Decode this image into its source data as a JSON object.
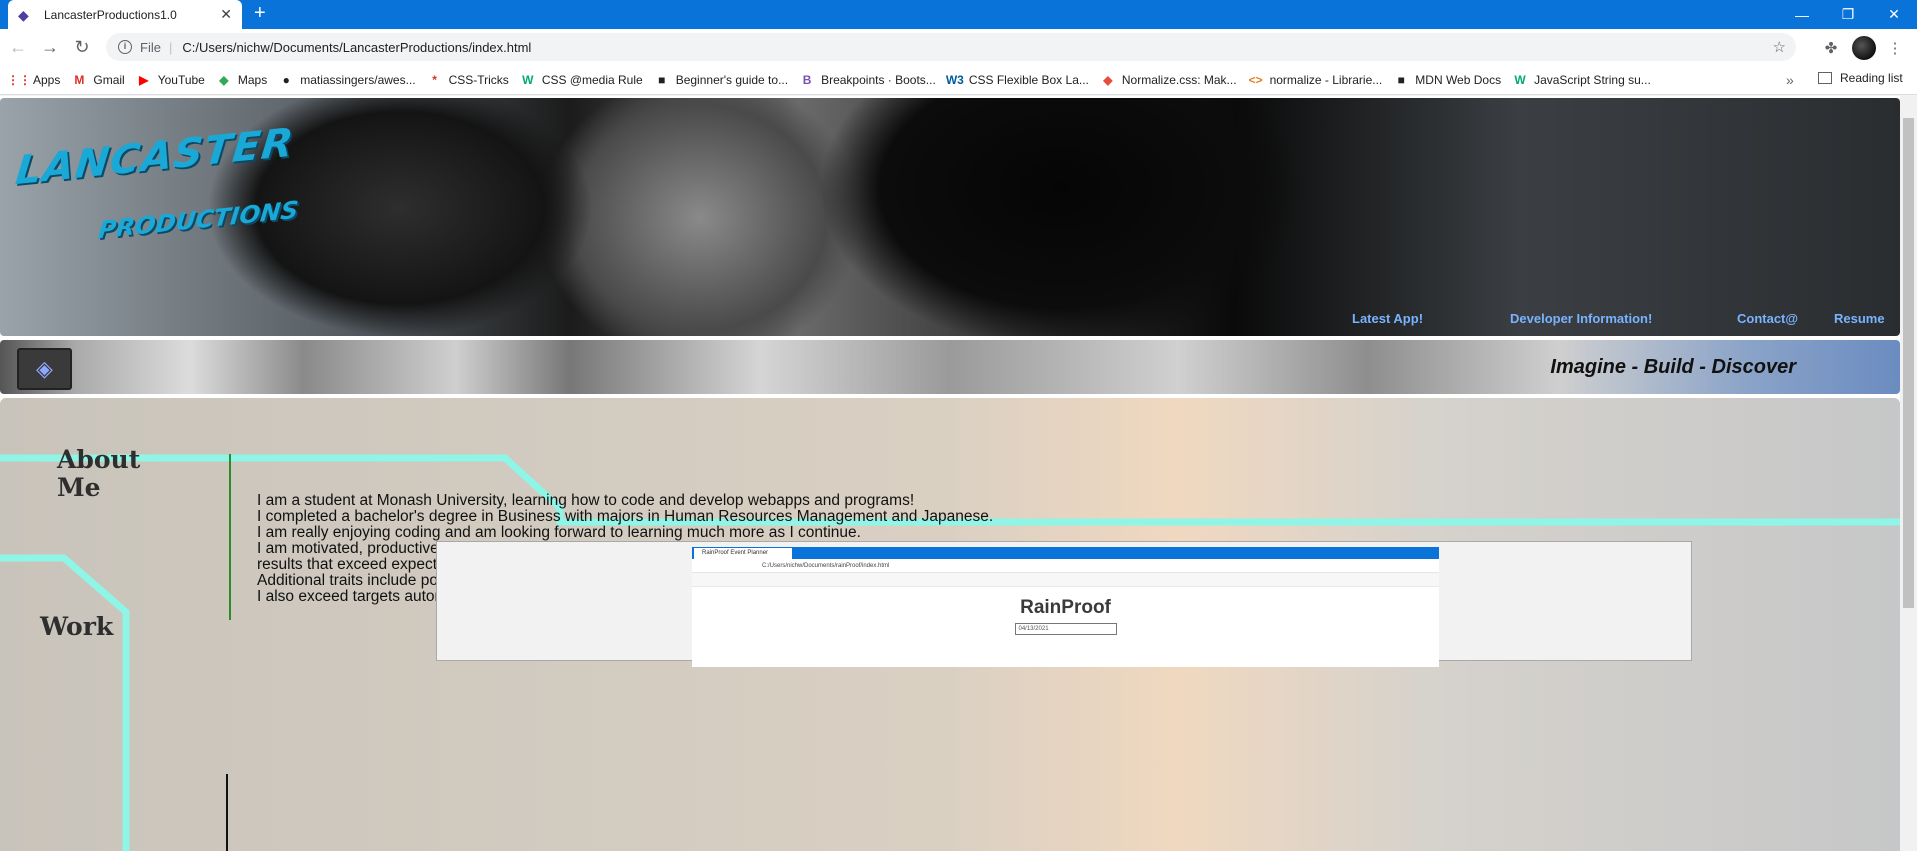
{
  "browser": {
    "tab_title": "LancasterProductions1.0",
    "new_tab": "+",
    "tab_close": "✕",
    "window_controls": {
      "minimize": "—",
      "restore": "❐",
      "close": "✕"
    },
    "nav": {
      "back": "←",
      "forward": "→",
      "reload": "↻"
    },
    "address": {
      "scheme_label": "File",
      "url": "C:/Users/nichw/Documents/LancasterProductions/index.html"
    },
    "bookmarks": [
      {
        "label": "Apps",
        "icon": "apps-grid-icon",
        "glyph": "⋮⋮",
        "color": "#d93025"
      },
      {
        "label": "Gmail",
        "icon": "gmail-icon",
        "glyph": "M",
        "color": "#d93025"
      },
      {
        "label": "YouTube",
        "icon": "youtube-icon",
        "glyph": "▶",
        "color": "#ff0000"
      },
      {
        "label": "Maps",
        "icon": "maps-icon",
        "glyph": "◆",
        "color": "#34a853"
      },
      {
        "label": "matiassingers/awes...",
        "icon": "github-icon",
        "glyph": "●",
        "color": "#202124"
      },
      {
        "label": "CSS-Tricks",
        "icon": "css-tricks-icon",
        "glyph": "*",
        "color": "#d93025"
      },
      {
        "label": "CSS @media Rule",
        "icon": "w3schools-icon",
        "glyph": "W",
        "color": "#04aa6d"
      },
      {
        "label": "Beginner's guide to...",
        "icon": "bookmark-page-icon",
        "glyph": "■",
        "color": "#202124"
      },
      {
        "label": "Breakpoints · Boots...",
        "icon": "bootstrap-icon",
        "glyph": "B",
        "color": "#7952b3"
      },
      {
        "label": "CSS Flexible Box La...",
        "icon": "w3c-icon",
        "glyph": "W3",
        "color": "#005a9c"
      },
      {
        "label": "Normalize.css: Mak...",
        "icon": "normalize-icon",
        "glyph": "◆",
        "color": "#e74c3c"
      },
      {
        "label": "normalize - Librarie...",
        "icon": "code-icon",
        "glyph": "<>",
        "color": "#e67e22"
      },
      {
        "label": "MDN Web Docs",
        "icon": "mdn-icon",
        "glyph": "■",
        "color": "#202124"
      },
      {
        "label": "JavaScript String su...",
        "icon": "w3schools-icon",
        "glyph": "W",
        "color": "#04aa6d"
      }
    ],
    "more": "»",
    "reading_list": "Reading list"
  },
  "site": {
    "logo_line1": "LANCASTER",
    "logo_line2": "PRODUCTIONS",
    "nav": [
      {
        "label": "Latest App!"
      },
      {
        "label": "Developer Information!"
      },
      {
        "label": "Contact@"
      },
      {
        "label": "Resume"
      }
    ],
    "tagline": "Imagine - Build - Discover",
    "about_heading": "About Me",
    "about_lines": [
      "I am a student at Monash University, learning how to code and develop webapps and programs!",
      "I completed a bachelor's degree in Business with majors in Human Resources Management and Japanese.",
      "I am really enjoying coding and am looking forward to learning much more as I continue.",
      "I am motivated, productive and encourage my fellow workers. I care passionately about applying the utmost effort to all work and deliver",
      "results that exceed expectations.",
      "Additional traits include positivity, energy and resilience. I am a team player and communicate well with others.",
      "I also exceed targets autonomously, which results in compliments and rewards"
    ],
    "work_heading": "Work",
    "work_preview": {
      "tab": "RainProof Event Planner",
      "url": "C:/Users/nichw/Documents/rainProof/index.html",
      "title": "RainProof",
      "date": "04/13/2021"
    }
  },
  "colors": {
    "chrome_blue": "#0a73d9",
    "nav_link": "#79b3ff",
    "circuit": "#8ff5e6",
    "about_divider": "#2f8a2a"
  }
}
